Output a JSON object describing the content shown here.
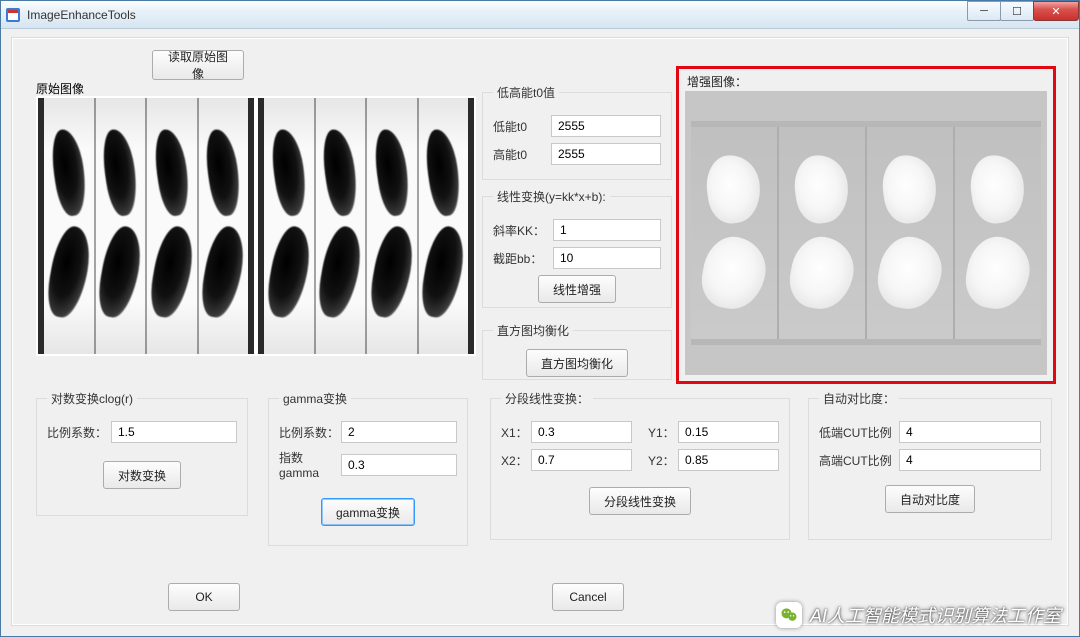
{
  "window": {
    "title": "ImageEnhanceTools"
  },
  "buttons": {
    "load": "读取原始图像",
    "linear_enhance": "线性增强",
    "hist_eq": "直方图均衡化",
    "log_transform": "对数变换",
    "gamma_transform": "gamma变换",
    "piecewise": "分段线性变换",
    "auto_contrast": "自动对比度",
    "ok": "OK",
    "cancel": "Cancel"
  },
  "labels": {
    "original_image": "原始图像",
    "enhanced_image": "增强图像：",
    "t0_group": "低高能t0值",
    "low_t0": "低能t0",
    "high_t0": "高能t0",
    "linear_group": "线性变换(y=kk*x+b):",
    "slope_kk": "斜率KK：",
    "intercept_bb": "截距bb：",
    "hist_group": "直方图均衡化",
    "log_group": "对数变换clog(r)",
    "ratio_coef": "比例系数：",
    "gamma_group": "gamma变换",
    "gamma_exp": "指数gamma",
    "piecewise_group": "分段线性变换：",
    "x1": "X1：",
    "y1": "Y1：",
    "x2": "X2：",
    "y2": "Y2：",
    "auto_group": "自动对比度：",
    "low_cut": "低端CUT比例",
    "high_cut": "高端CUT比例"
  },
  "values": {
    "low_t0": "2555",
    "high_t0": "2555",
    "kk": "1",
    "bb": "10",
    "log_ratio": "1.5",
    "gamma_ratio": "2",
    "gamma_exp": "0.3",
    "x1": "0.3",
    "y1": "0.15",
    "x2": "0.7",
    "y2": "0.85",
    "low_cut": "4",
    "high_cut": "4"
  },
  "watermark": {
    "text": "AI人工智能模式识别算法工作室"
  }
}
